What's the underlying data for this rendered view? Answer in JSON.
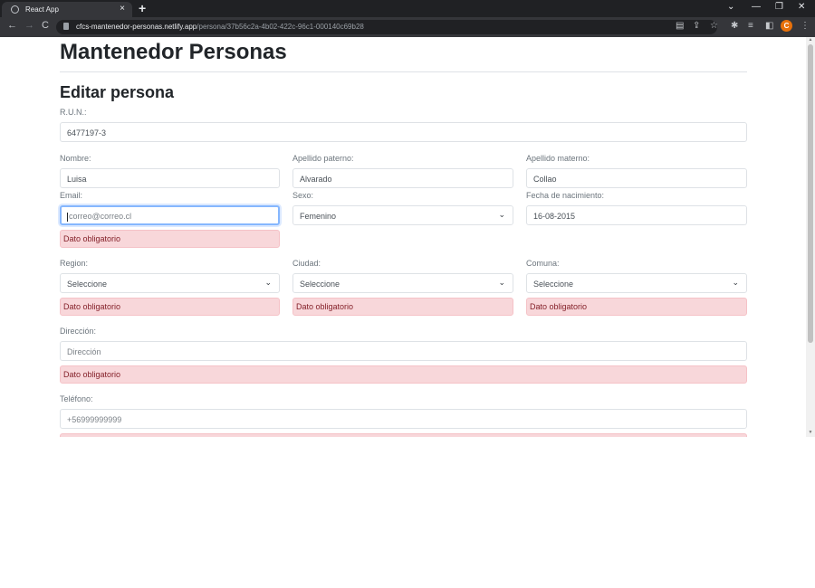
{
  "browser": {
    "tab_title": "React App",
    "tab_close": "×",
    "new_tab": "+",
    "url_host": "cfcs-mantenedor-personas.netlify.app",
    "url_path": "/persona/37b56c2a-4b02-422c-96c1-000140c69b28",
    "profile_initial": "C"
  },
  "page": {
    "title": "Mantenedor Personas",
    "form_title": "Editar persona"
  },
  "form": {
    "run": {
      "label": "R.U.N.:",
      "value": "6477197-3"
    },
    "nombre": {
      "label": "Nombre:",
      "value": "Luisa"
    },
    "apellido_paterno": {
      "label": "Apellido paterno:",
      "value": "Alvarado"
    },
    "apellido_materno": {
      "label": "Apellido materno:",
      "value": "Collao"
    },
    "email": {
      "label": "Email:",
      "value": "",
      "placeholder": "correo@correo.cl",
      "error": "Dato obligatorio"
    },
    "sexo": {
      "label": "Sexo:",
      "value": "Femenino"
    },
    "fecha_nacimiento": {
      "label": "Fecha de nacimiento:",
      "value": "16-08-2015"
    },
    "region": {
      "label": "Region:",
      "value": "Seleccione",
      "error": "Dato obligatorio"
    },
    "ciudad": {
      "label": "Ciudad:",
      "value": "Seleccione",
      "error": "Dato obligatorio"
    },
    "comuna": {
      "label": "Comuna:",
      "value": "Seleccione",
      "error": "Dato obligatorio"
    },
    "direccion": {
      "label": "Dirección:",
      "value": "",
      "placeholder": "Dirección",
      "error": "Dato obligatorio"
    },
    "telefono": {
      "label": "Teléfono:",
      "value": "",
      "placeholder": "+56999999999"
    }
  },
  "colors": {
    "error_bg": "#f8d7da",
    "error_text": "#842029",
    "focus_border": "#86b7fe"
  }
}
